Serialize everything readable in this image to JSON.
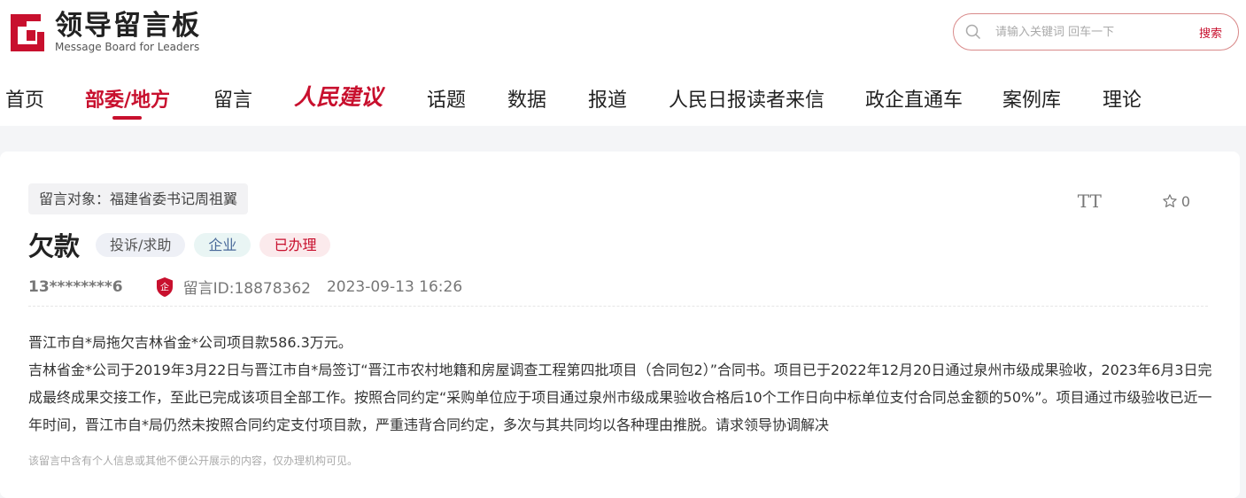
{
  "header": {
    "logo_title": "领导留言板",
    "logo_subtitle": "Message Board for Leaders",
    "search": {
      "placeholder": "请输入关键词 回车一下",
      "button_label": "搜索"
    }
  },
  "nav": {
    "items": [
      "首页",
      "部委/地方",
      "留言",
      "人民建议",
      "话题",
      "数据",
      "报道",
      "人民日报读者来信",
      "政企直通车",
      "案例库",
      "理论"
    ],
    "active": "部委/地方"
  },
  "message": {
    "target": "留言对象：福建省委书记周祖翼",
    "title": "欠款",
    "tags": {
      "category": "投诉/求助",
      "type": "企业",
      "status": "已办理"
    },
    "author": "13********6",
    "author_badge": "企",
    "id_label": "留言ID:18878362",
    "datetime": "2023-09-13 16:26",
    "favorite_count": "0",
    "font_tool_label": "TT",
    "paragraphs": [
      "晋江市自*局拖欠吉林省金*公司项目款586.3万元。",
      "吉林省金*公司于2019年3月22日与晋江市自*局签订“晋江市农村地籍和房屋调查工程第四批项目（合同包2）”合同书。项目已于2022年12月20日通过泉州市级成果验收，2023年6月3日完成最终成果交接工作，至此已完成该项目全部工作。按照合同约定“采购单位应于项目通过泉州市级成果验收合格后10个工作日向中标单位支付合同总金额的50%”。项目通过市级验收已近一年时间，晋江市自*局仍然未按照合同约定支付项目款，严重违背合同约定，多次与其共同均以各种理由推脱。请求领导协调解决"
    ],
    "notice": "该留言中含有个人信息或其他不便公开展示的内容，仅办理机构可见。"
  },
  "colors": {
    "brand_red": "#c8102e"
  }
}
